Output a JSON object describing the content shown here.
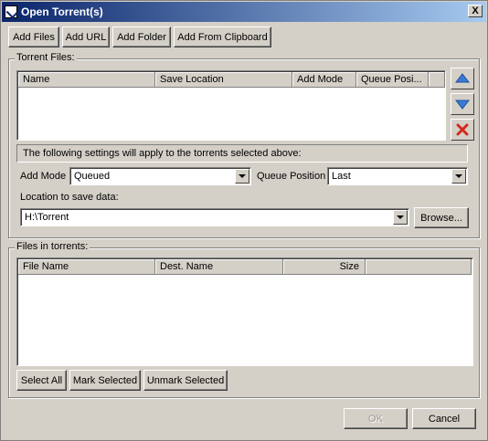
{
  "window": {
    "title": "Open Torrent(s)",
    "close_label": "X"
  },
  "toolbar": {
    "add_files": "Add Files",
    "add_url": "Add URL",
    "add_folder": "Add Folder",
    "add_clipboard": "Add From Clipboard"
  },
  "torrent_files": {
    "legend": "Torrent Files:",
    "columns": [
      "Name",
      "Save Location",
      "Add Mode",
      "Queue Posi..."
    ]
  },
  "settings": {
    "info": "The following settings will apply to the torrents selected above:",
    "add_mode_label": "Add Mode",
    "add_mode_value": "Queued",
    "queue_position_label": "Queue Position",
    "queue_position_value": "Last",
    "location_label": "Location to save data:",
    "location_value": "H:\\Torrent",
    "browse_label": "Browse..."
  },
  "files_in_torrents": {
    "legend": "Files in torrents:",
    "columns": [
      "File Name",
      "Dest. Name",
      "Size"
    ],
    "select_all": "Select All",
    "mark_selected": "Mark Selected",
    "unmark_selected": "Unmark Selected"
  },
  "footer": {
    "ok": "OK",
    "cancel": "Cancel"
  },
  "icons": {
    "move_up": "up-arrow-icon",
    "move_down": "down-arrow-icon",
    "remove": "red-x-icon"
  },
  "colors": {
    "title_start": "#0a246a",
    "title_end": "#a6caf0",
    "arrow_blue": "#3b7bd6",
    "remove_red": "#d42a1e"
  }
}
